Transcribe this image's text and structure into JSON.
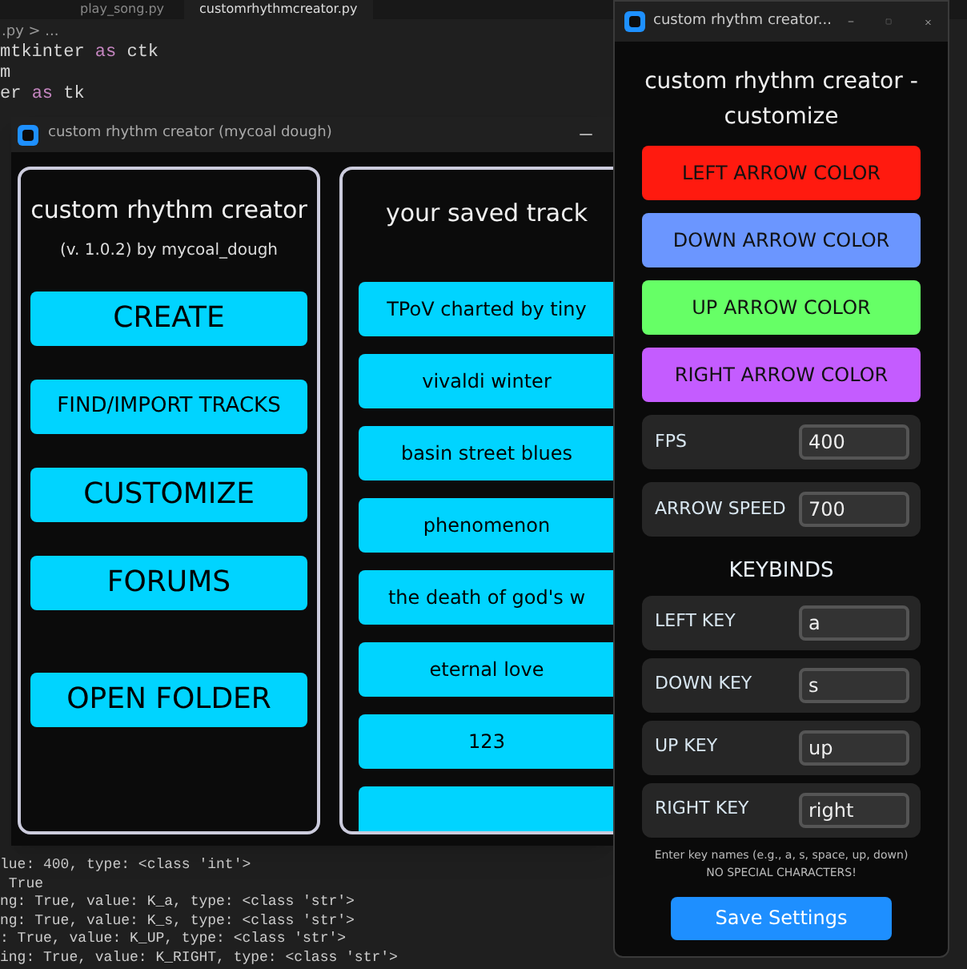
{
  "editor": {
    "tabs": [
      {
        "label": "play_song.py",
        "selected": false
      },
      {
        "label": "customrhythmcreator.py",
        "selected": true
      }
    ],
    "breadcrumb": ".py > ...",
    "code_lines": [
      [
        {
          "text": "mtkinter ",
          "kind": "plain"
        },
        {
          "text": "as",
          "kind": "keyword"
        },
        {
          "text": " ctk",
          "kind": "plain"
        }
      ],
      [
        {
          "text": "m",
          "kind": "plain"
        }
      ],
      [
        {
          "text": "er ",
          "kind": "plain"
        },
        {
          "text": "as",
          "kind": "keyword"
        },
        {
          "text": " tk",
          "kind": "plain"
        }
      ]
    ],
    "terminal_lines": [
      "lue: 400, type: <class 'int'>",
      " True",
      "ng: True, value: K_a, type: <class 'str'>",
      "ng: True, value: K_s, type: <class 'str'>",
      ": True, value: K_UP, type: <class 'str'>",
      "ing: True, value: K_RIGHT, type: <class 'str'>"
    ]
  },
  "main_window": {
    "title": "custom rhythm creator (mycoal dough)",
    "menu_panel": {
      "title": "custom rhythm creator",
      "subtitle": "(v. 1.0.2) by mycoal_dough",
      "buttons": [
        "CREATE",
        "FIND/IMPORT TRACKS",
        "CUSTOMIZE",
        "FORUMS",
        "OPEN FOLDER"
      ]
    },
    "saved_tracks": {
      "title": "your saved track",
      "items": [
        "TPoV charted by tiny",
        "vivaldi winter",
        "basin street blues",
        "phenomenon",
        "the death of god's w",
        "eternal love",
        "123"
      ]
    }
  },
  "customize_window": {
    "title": "custom rhythm creator...",
    "heading": "custom rhythm creator - customize",
    "color_buttons": [
      {
        "label": "LEFT ARROW COLOR",
        "color": "#ff1a0f"
      },
      {
        "label": "DOWN ARROW COLOR",
        "color": "#6b96ff"
      },
      {
        "label": "UP ARROW COLOR",
        "color": "#66ff66"
      },
      {
        "label": "RIGHT ARROW COLOR",
        "color": "#c45cff"
      }
    ],
    "settings": [
      {
        "label": "FPS",
        "value": "400"
      },
      {
        "label": "ARROW SPEED",
        "value": "700"
      }
    ],
    "keybinds_title": "KEYBINDS",
    "keybinds": [
      {
        "label": "LEFT KEY",
        "value": "a"
      },
      {
        "label": "DOWN KEY",
        "value": "s"
      },
      {
        "label": "UP KEY",
        "value": "up"
      },
      {
        "label": "RIGHT KEY",
        "value": "right"
      }
    ],
    "hint": [
      "Enter key names (e.g., a, s, space, up, down)",
      "NO SPECIAL CHARACTERS!"
    ],
    "save_button": "Save Settings"
  }
}
